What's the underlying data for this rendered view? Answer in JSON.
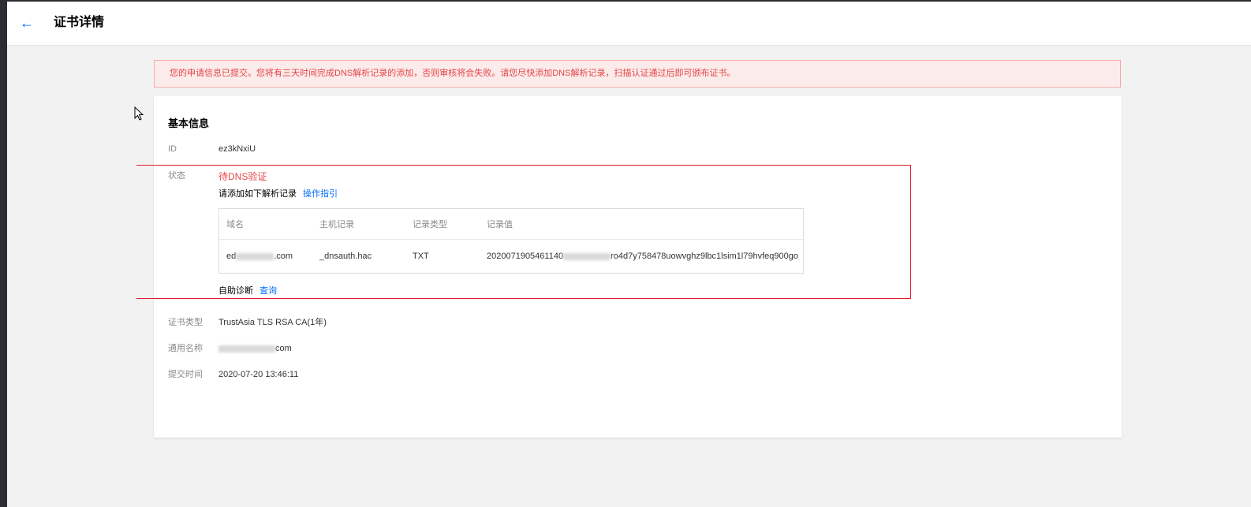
{
  "header": {
    "back_icon": "arrow-left-icon",
    "title": "证书详情"
  },
  "alert": {
    "text": "您的申请信息已提交。您将有三天时间完成DNS解析记录的添加，否则审核将会失败。请您尽快添加DNS解析记录，扫描认证通过后即可颁布证书。"
  },
  "basic_info": {
    "title": "基本信息",
    "id_label": "ID",
    "id_value": "ez3kNxiU",
    "status_label": "状态",
    "status_value": "待DNS验证",
    "add_record_text": "请添加如下解析记录",
    "guide_link": "操作指引",
    "dns_table": {
      "columns": [
        "域名",
        "主机记录",
        "记录类型",
        "记录值"
      ],
      "rows": [
        {
          "domain_prefix": "ed",
          "domain_suffix": ".com",
          "host": "_dnsauth.hac",
          "type": "TXT",
          "value_prefix": "2020071905461140",
          "value_suffix": "ro4d7y758478uowvghz9lbc1lsim1l79hvfeq900go"
        }
      ]
    },
    "diagnosis_label": "自助诊断",
    "diagnosis_link": "查询",
    "cert_type_label": "证书类型",
    "cert_type_value": "TrustAsia TLS RSA CA(1年)",
    "common_name_label": "通用名称",
    "common_name_suffix": "com",
    "submit_time_label": "提交时间",
    "submit_time_value": "2020-07-20 13:46:11"
  },
  "colors": {
    "accent": "#006eff",
    "danger": "#e54545",
    "alert_bg": "#fcebeb"
  }
}
